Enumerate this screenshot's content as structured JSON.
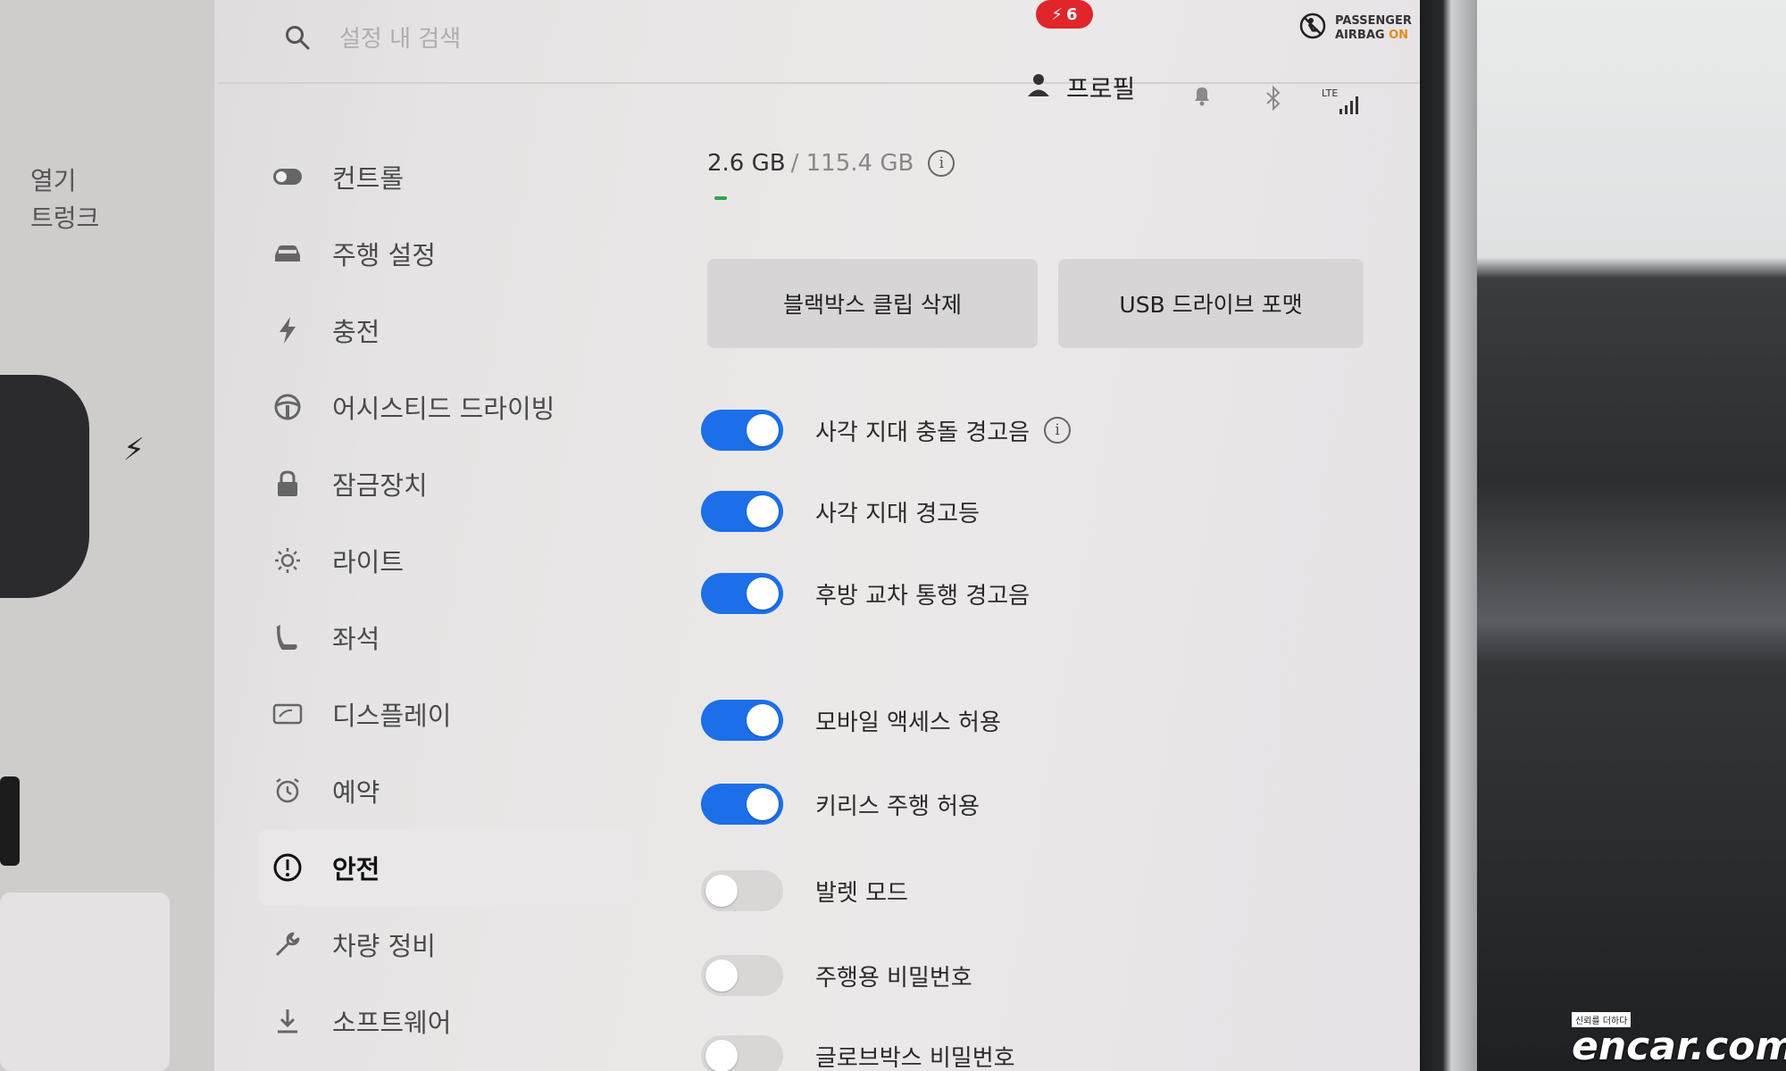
{
  "search": {
    "placeholder": "설정 내 검색"
  },
  "car_panel": {
    "open_label": "열기",
    "trunk_label": "트렁크"
  },
  "status_bar": {
    "notification_count": "6",
    "profile_label": "프로필",
    "network_label": "LTE",
    "airbag_line1": "PASSENGER",
    "airbag_line2": "AIRBAG",
    "airbag_state": "ON"
  },
  "sidebar": {
    "items": [
      {
        "label": "컨트롤",
        "icon": "toggle-icon"
      },
      {
        "label": "주행 설정",
        "icon": "car-icon"
      },
      {
        "label": "충전",
        "icon": "lightning-icon"
      },
      {
        "label": "어시스티드 드라이빙",
        "icon": "steering-wheel-icon"
      },
      {
        "label": "잠금장치",
        "icon": "lock-icon"
      },
      {
        "label": "라이트",
        "icon": "sun-icon"
      },
      {
        "label": "좌석",
        "icon": "seat-icon"
      },
      {
        "label": "디스플레이",
        "icon": "display-icon"
      },
      {
        "label": "예약",
        "icon": "alarm-icon"
      },
      {
        "label": "안전",
        "icon": "alert-circle-icon",
        "active": true
      },
      {
        "label": "차량 정비",
        "icon": "wrench-icon"
      },
      {
        "label": "소프트웨어",
        "icon": "download-icon"
      }
    ]
  },
  "main": {
    "storage_used": "2.6 GB",
    "storage_total": "/ 115.4 GB",
    "storage_used_fraction": 0.023,
    "buttons": {
      "delete_clips": "블랙박스 클립 삭제",
      "format_usb": "USB 드라이브 포맷"
    },
    "toggles": [
      {
        "label": "사각 지대 충돌 경고음",
        "on": true,
        "info": true
      },
      {
        "label": "사각 지대 경고등",
        "on": true
      },
      {
        "label": "후방 교차 통행 경고음",
        "on": true
      },
      {
        "label": "모바일 액세스 허용",
        "on": true
      },
      {
        "label": "키리스 주행 허용",
        "on": true
      },
      {
        "label": "발렛 모드",
        "on": false
      },
      {
        "label": "주행용 비밀번호",
        "on": false
      },
      {
        "label": "글로브박스 비밀번호",
        "on": false
      }
    ]
  },
  "watermark": {
    "tag": "신뢰를 더하다",
    "logo": "encar.com"
  },
  "colors": {
    "toggle_on": "#1c6fe8",
    "notification": "#e0262b",
    "airbag_on": "#e08a1a"
  }
}
